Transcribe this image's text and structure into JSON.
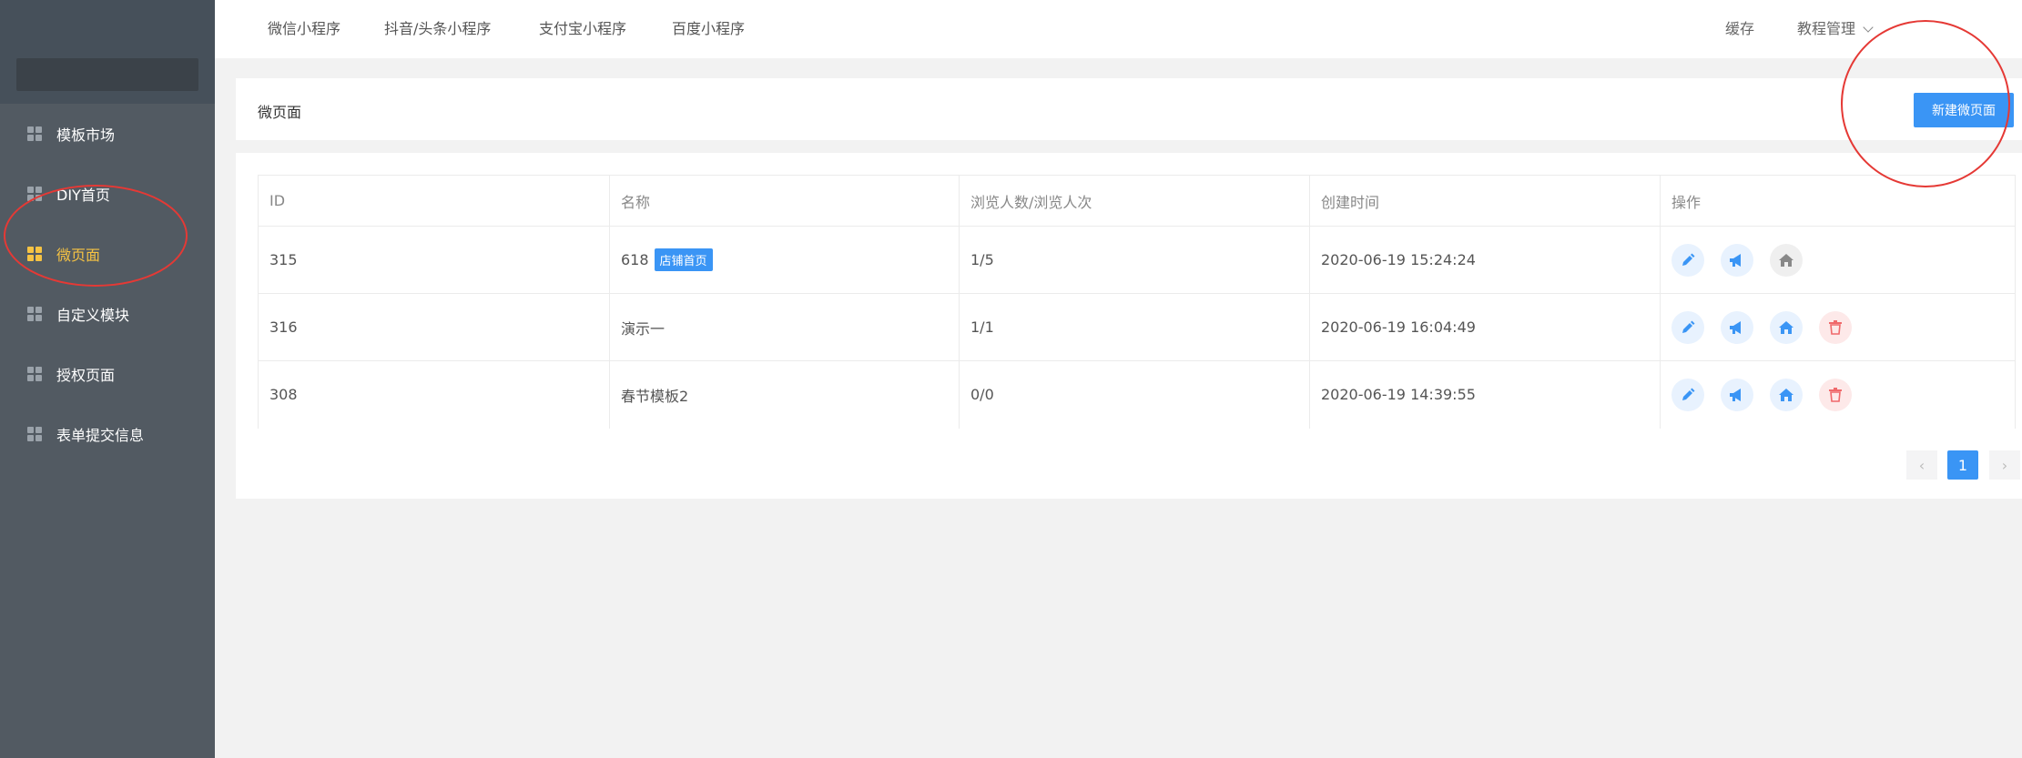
{
  "sidebar": {
    "items": [
      {
        "label": "模板市场",
        "active": false
      },
      {
        "label": "DIY首页",
        "active": false
      },
      {
        "label": "微页面",
        "active": true
      },
      {
        "label": "自定义模块",
        "active": false
      },
      {
        "label": "授权页面",
        "active": false
      },
      {
        "label": "表单提交信息",
        "active": false
      }
    ]
  },
  "topbar": {
    "tabs": [
      "微信小程序",
      "抖音/头条小程序",
      "支付宝小程序",
      "百度小程序"
    ],
    "right": [
      "缓存",
      "教程管理"
    ]
  },
  "header": {
    "title": "微页面",
    "new_button": "新建微页面"
  },
  "table": {
    "columns": [
      "ID",
      "名称",
      "浏览人数/浏览人次",
      "创建时间",
      "操作"
    ],
    "rows": [
      {
        "id": "315",
        "name": "618",
        "tag": "店铺首页",
        "views": "1/5",
        "created": "2020-06-19 15:24:24",
        "actions": [
          "edit-icon",
          "promote-icon",
          "home-icon"
        ]
      },
      {
        "id": "316",
        "name": "演示一",
        "tag": "",
        "views": "1/1",
        "created": "2020-06-19 16:04:49",
        "actions": [
          "edit-icon",
          "promote-icon",
          "home-icon",
          "delete-icon"
        ]
      },
      {
        "id": "308",
        "name": "春节模板2",
        "tag": "",
        "views": "0/0",
        "created": "2020-06-19 14:39:55",
        "actions": [
          "edit-icon",
          "promote-icon",
          "home-icon",
          "delete-icon"
        ]
      }
    ]
  },
  "pagination": {
    "prev": "‹",
    "current": "1",
    "next": "›"
  },
  "colors": {
    "accent": "#3a95f5",
    "sidebar": "#525a62",
    "active_menu": "#f6c343",
    "annotation": "#e53935",
    "delete": "#f0696b"
  }
}
